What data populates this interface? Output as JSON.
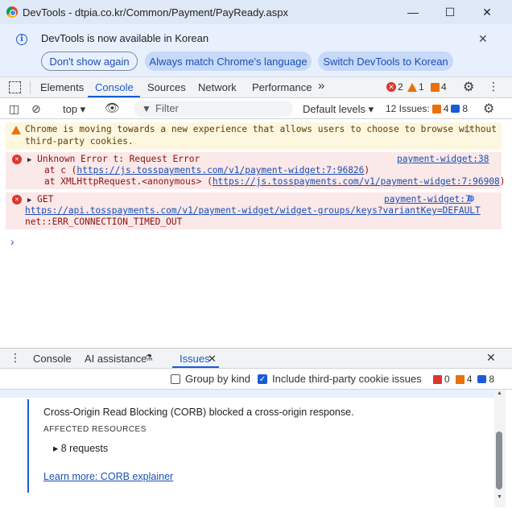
{
  "window": {
    "title": "DevTools - dtpia.co.kr/Common/Payment/PayReady.aspx",
    "minimize": "—",
    "maximize": "☐",
    "close": "✕"
  },
  "infobar": {
    "message": "DevTools is now available in Korean",
    "buttons": [
      "Don't show again",
      "Always match Chrome's language",
      "Switch DevTools to Korean"
    ],
    "close": "✕"
  },
  "main_tabs": [
    "Elements",
    "Console",
    "Sources",
    "Network",
    "Performance"
  ],
  "more_tabs": "»",
  "status_counts": {
    "errors": "2",
    "warnings": "1",
    "issues": "4"
  },
  "console_toolbar": {
    "context": "top ▾",
    "filter_placeholder": "Filter",
    "levels": "Default levels ▾",
    "issues_label": "12 Issues:",
    "issues_warn": "4",
    "issues_info": "8"
  },
  "messages": {
    "warning": {
      "line1": "Chrome is moving towards a new experience that allows users to choose to browse without",
      "line2": "third-party cookies."
    },
    "error1": {
      "head": "Unknown Error t: Request Error",
      "source": "payment-widget:38",
      "l2_prefix": "at c (",
      "l2_link": "https://js.tosspayments.com/v1/payment-widget:7:96826",
      "l2_suffix": ")",
      "l3_prefix": "at XMLHttpRequest.<anonymous> (",
      "l3_link": "https://js.tosspayments.com/v1/payment-widget:7:96908",
      "l3_suffix": ")"
    },
    "error2": {
      "head": "GET",
      "source": "payment-widget:7",
      "url": "https://api.tosspayments.com/v1/payment-widget/widget-groups/keys?variantKey=DEFAULT",
      "status": "net::ERR_CONNECTION_TIMED_OUT"
    },
    "prompt": "›"
  },
  "drawer": {
    "tabs": [
      "Console",
      "AI assistance",
      "Issues"
    ],
    "group_by_kind": "Group by kind",
    "include_third_party": "Include third-party cookie issues",
    "counts": {
      "errors": "0",
      "warnings": "4",
      "info": "8"
    },
    "issue": {
      "title": "Cross-Origin Read Blocking (CORB) blocked a cross-origin response.",
      "affected": "AFFECTED RESOURCES",
      "requests": "▸ 8 requests",
      "learn_more": "Learn more: CORB explainer"
    }
  },
  "colors": {
    "accent": "#1a5bd6",
    "error": "#dc362e",
    "warning": "#e8710a",
    "titlebar": "#dfe8f6"
  }
}
